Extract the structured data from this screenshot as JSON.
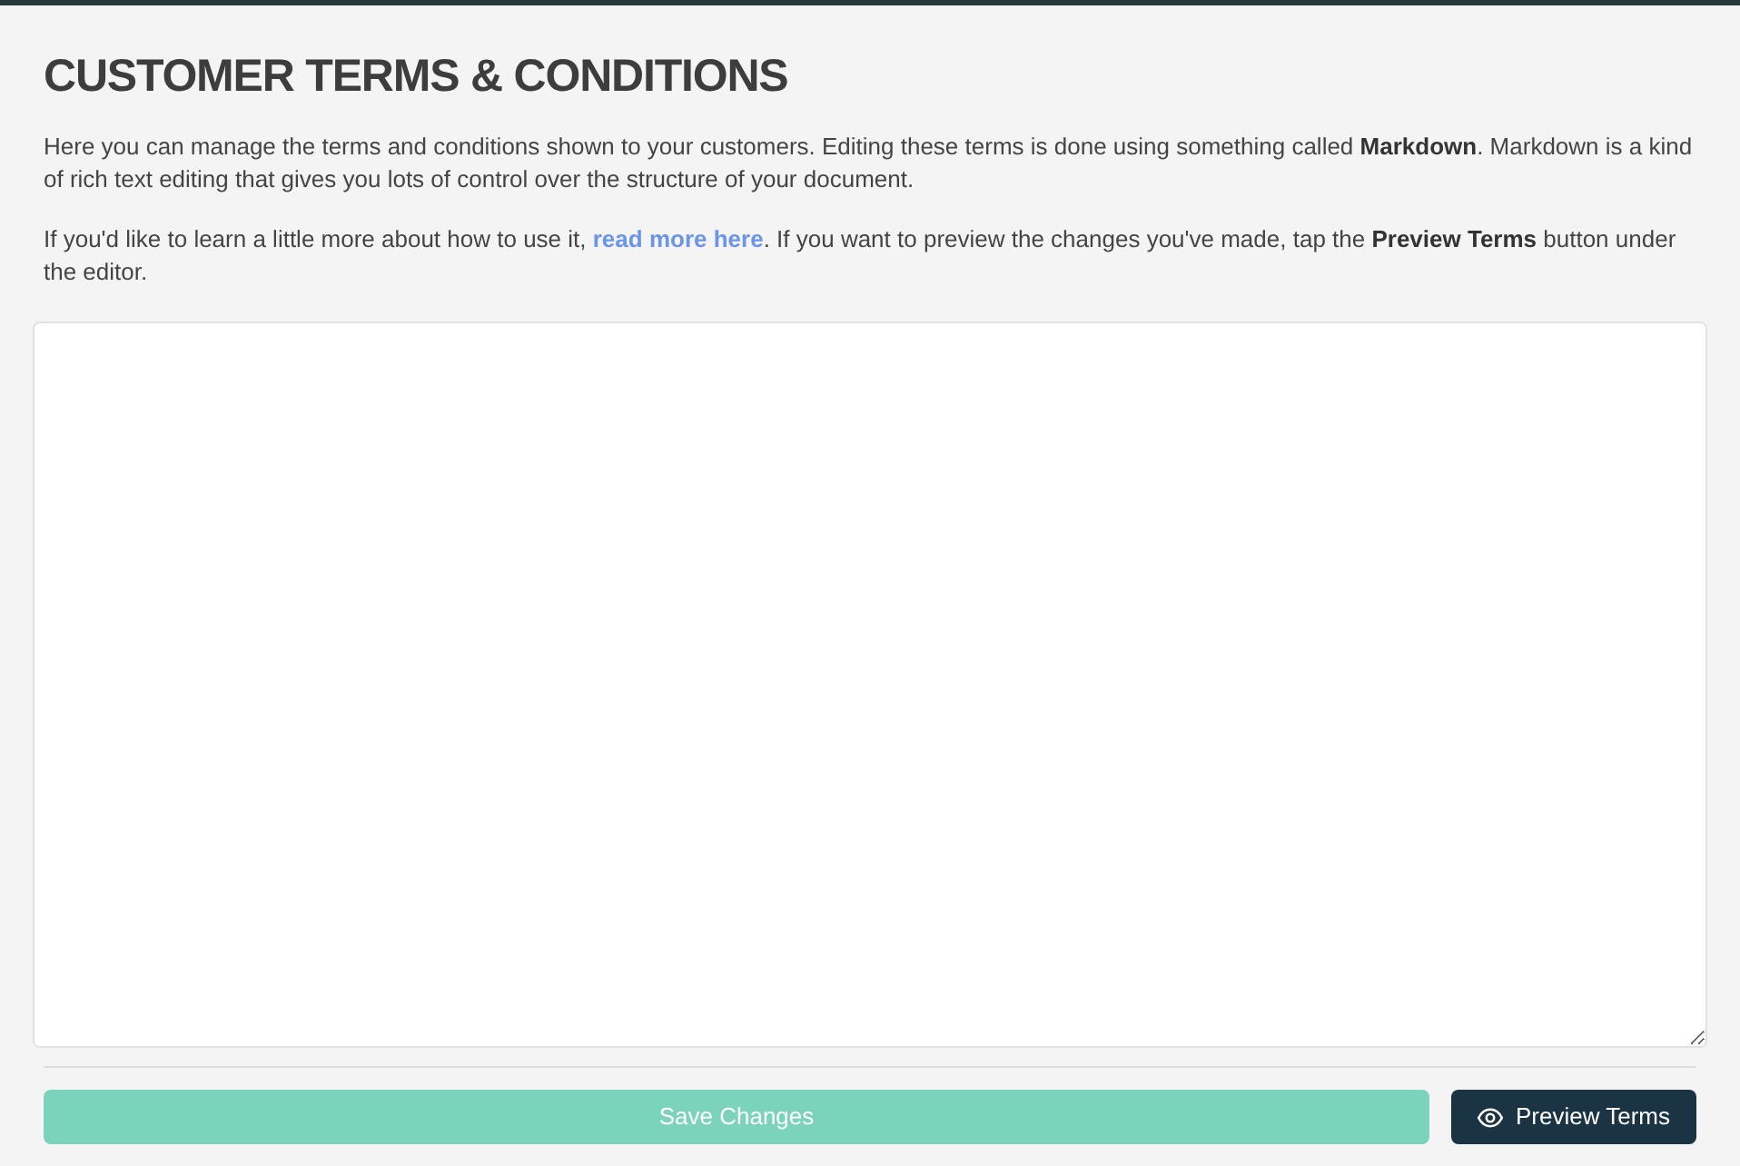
{
  "title": "CUSTOMER TERMS & CONDITIONS",
  "intro": [
    {
      "kind": "text",
      "text": "Here you can manage the terms and conditions shown to your customers. Editing these terms is done using something called **Markdown**. Markdown is a kind of rich text editing that gives you lots of control over the structure of your document."
    },
    {
      "kind": "link",
      "before": "If you'd like to learn a little more about how to use it, ",
      "link": "read more here",
      "after": ". If you want to preview the changes you've made, tap the **Preview Terms** button under the editor."
    }
  ],
  "editor": {
    "resizable": true
  },
  "buttons": [
    {
      "kind": "save",
      "label": "Save Changes",
      "disabled": true
    },
    {
      "kind": "preview",
      "label": "Preview Terms",
      "disabled": false
    }
  ]
}
